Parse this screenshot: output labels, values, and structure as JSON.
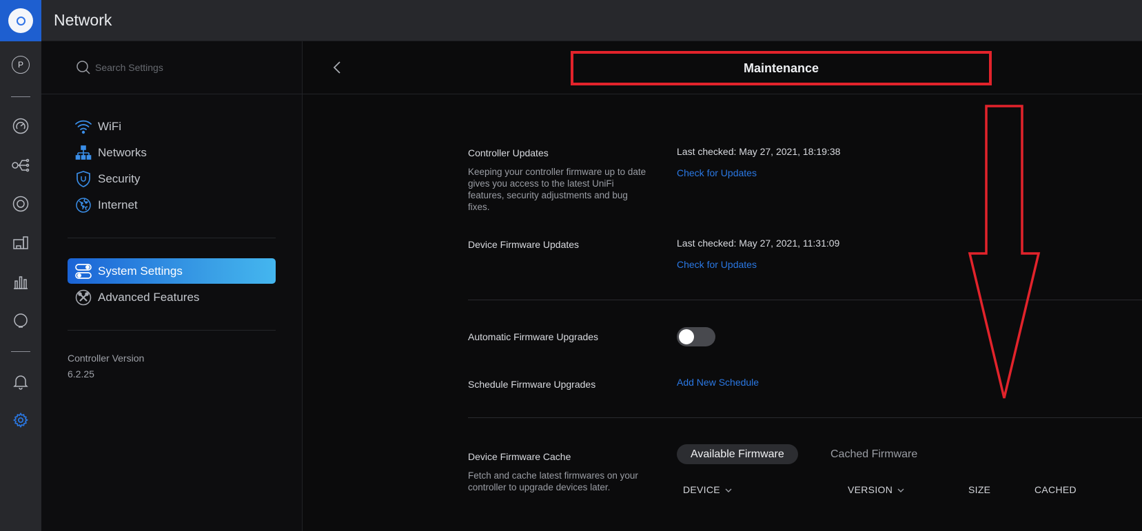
{
  "app": {
    "title": "Network"
  },
  "rail": {
    "profile_letter": "P",
    "icons": [
      "dashboard-icon",
      "topology-icon",
      "devices-icon",
      "clients-icon",
      "statistics-icon",
      "insights-icon",
      "notifications-icon",
      "settings-icon"
    ]
  },
  "sidebar": {
    "search": {
      "placeholder": "Search Settings"
    },
    "items": [
      {
        "label": "WiFi",
        "icon": "wifi-icon"
      },
      {
        "label": "Networks",
        "icon": "networks-icon"
      },
      {
        "label": "Security",
        "icon": "shield-icon"
      },
      {
        "label": "Internet",
        "icon": "globe-icon"
      },
      {
        "label": "System Settings",
        "icon": "toggles-icon",
        "active": true
      },
      {
        "label": "Advanced Features",
        "icon": "tools-icon"
      }
    ],
    "controller_version_label": "Controller Version",
    "controller_version": "6.2.25"
  },
  "main": {
    "title": "Maintenance",
    "controller_updates": {
      "label": "Controller Updates",
      "description": "Keeping your controller firmware up to date gives you access to the latest UniFi features, security adjustments and bug fixes.",
      "last_checked": "Last checked: May 27, 2021, 18:19:38",
      "action": "Check for Updates"
    },
    "device_firmware_updates": {
      "label": "Device Firmware Updates",
      "last_checked": "Last checked: May 27, 2021, 11:31:09",
      "action": "Check for Updates"
    },
    "automatic_upgrades": {
      "label": "Automatic Firmware Upgrades",
      "enabled": false
    },
    "schedule_upgrades": {
      "label": "Schedule Firmware Upgrades",
      "action": "Add New Schedule"
    },
    "firmware_cache": {
      "label": "Device Firmware Cache",
      "description": "Fetch and cache latest firmwares on your controller to upgrade devices later.",
      "tabs": [
        "Available Firmware",
        "Cached Firmware"
      ],
      "selected_tab": "Available Firmware",
      "columns": [
        "DEVICE",
        "VERSION",
        "SIZE",
        "CACHED"
      ]
    }
  },
  "colors": {
    "accent": "#2a78e4",
    "annotation": "#e2232b",
    "active_nav_start": "#1a63d6",
    "active_nav_end": "#44b6ef"
  }
}
